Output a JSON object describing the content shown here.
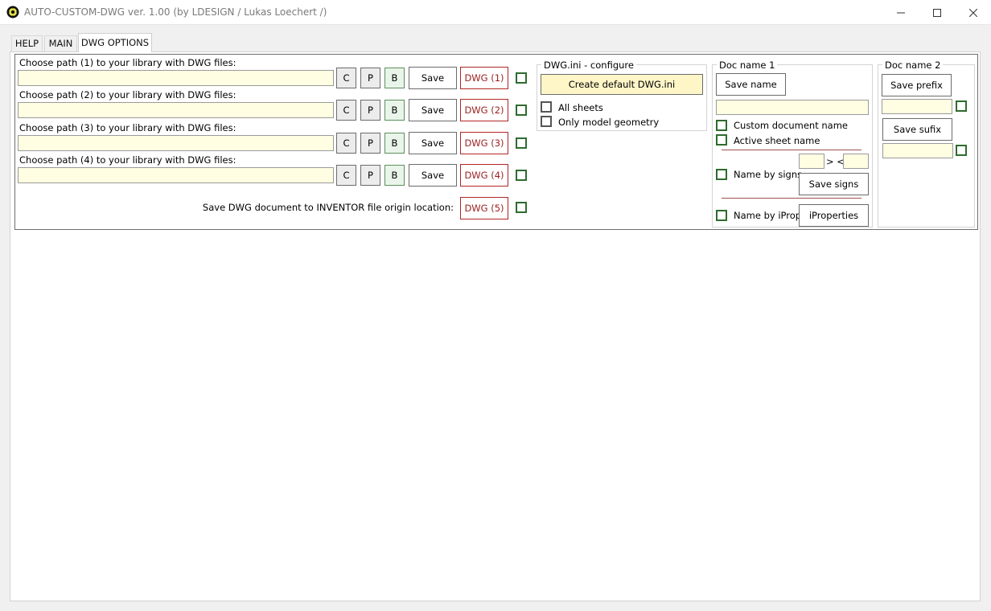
{
  "window": {
    "title": "AUTO-CUSTOM-DWG ver. 1.00 (by LDESIGN / Lukas Loechert /)",
    "controls": {
      "minimize": "—",
      "maximize": "☐",
      "close": "✕"
    }
  },
  "tabs": [
    "HELP",
    "MAIN",
    "DWG OPTIONS"
  ],
  "active_tab": "DWG OPTIONS",
  "paths": [
    {
      "label": "Choose path (1) to your library with DWG files:",
      "value": "",
      "c": "C",
      "p": "P",
      "b": "B",
      "save": "Save",
      "dwg": "DWG (1)"
    },
    {
      "label": "Choose path (2) to your library with DWG files:",
      "value": "",
      "c": "C",
      "p": "P",
      "b": "B",
      "save": "Save",
      "dwg": "DWG (2)"
    },
    {
      "label": "Choose path (3) to your library with DWG files:",
      "value": "",
      "c": "C",
      "p": "P",
      "b": "B",
      "save": "Save",
      "dwg": "DWG (3)"
    },
    {
      "label": "Choose path (4) to your library with DWG files:",
      "value": "",
      "c": "C",
      "p": "P",
      "b": "B",
      "save": "Save",
      "dwg": "DWG (4)"
    }
  ],
  "origin": {
    "label": "Save DWG document to INVENTOR file origin location:",
    "dwg": "DWG (5)"
  },
  "dwg_ini": {
    "title": "DWG.ini - configure",
    "create_button": "Create default DWG.ini",
    "all_sheets": "All sheets",
    "only_model": "Only model geometry"
  },
  "doc_name_1": {
    "title": "Doc name 1",
    "save_name": "Save name",
    "custom_document_name": "Custom document name",
    "active_sheet_name": "Active sheet name",
    "name_by_signs": "Name by signs",
    "signs_separator": "> <",
    "save_signs": "Save signs",
    "name_by_iprop": "Name by iProp",
    "iproperties": "iProperties"
  },
  "doc_name_2": {
    "title": "Doc name 2",
    "save_prefix": "Save prefix",
    "save_sufix": "Save sufix"
  },
  "colors": {
    "input_bg": "#fffde2",
    "create_btn_bg": "#fff6c8",
    "checkbox_border": "#2e6b2e",
    "dwg_button_border": "#b32525"
  }
}
